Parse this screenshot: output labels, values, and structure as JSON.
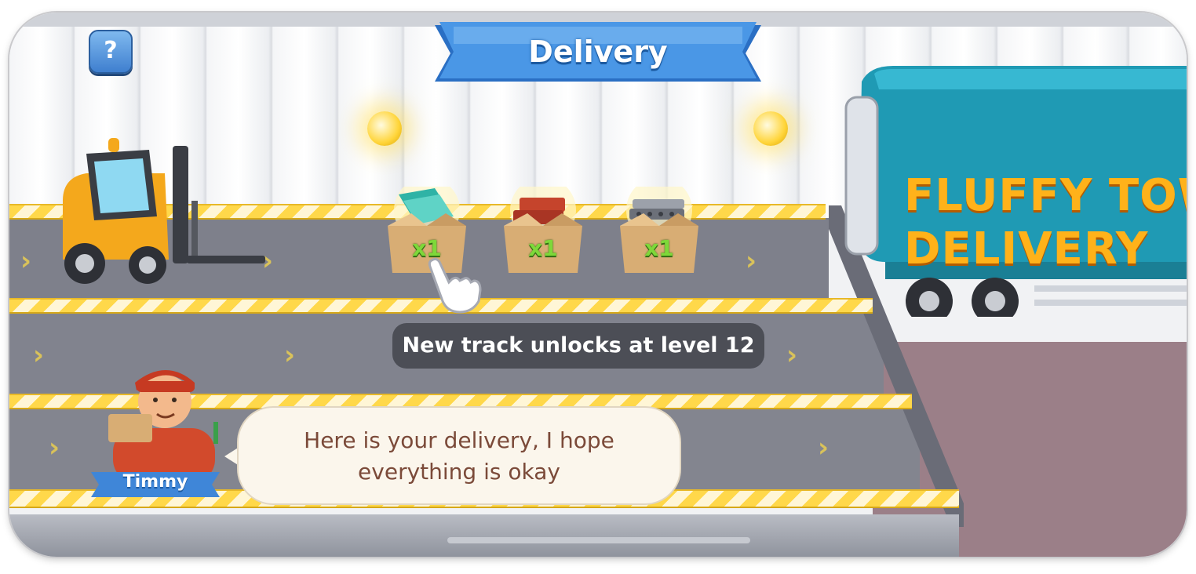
{
  "header": {
    "title": "Delivery",
    "help_icon": "question-mark-icon",
    "help_label": "?"
  },
  "boxes": [
    {
      "item_icon": "glass-panels-icon",
      "quantity": "x1"
    },
    {
      "item_icon": "bricks-icon",
      "quantity": "x1"
    },
    {
      "item_icon": "concrete-slab-icon",
      "quantity": "x1"
    }
  ],
  "notice": {
    "text": "New track unlocks at level 12"
  },
  "character": {
    "name": "Timmy",
    "speech": "Here is your delivery, I hope everything is okay"
  },
  "truck": {
    "line1": "FLUFFY TOW",
    "line2": "DELIVERY"
  },
  "colors": {
    "accent_blue": "#3f86d8",
    "lane_gray": "#7b7d88",
    "truck_teal": "#1f9ab4",
    "text_orange": "#ffb21a",
    "qty_green": "#7ed83a"
  }
}
